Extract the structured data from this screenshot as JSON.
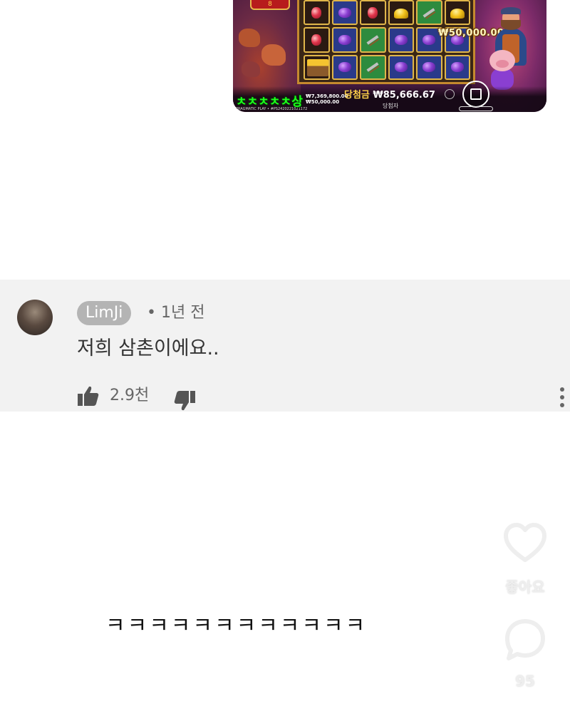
{
  "game": {
    "top_badge": "8",
    "win_amount_center": "₩50,000.00",
    "win_label": "당첨금",
    "win_total": "₩85,666.67",
    "winner_label": "당첨자",
    "balance_line1": "₩7,369,800.00",
    "balance_line2": "₩50,000.00",
    "provider": "PRAGMATIC PLAY • #PS2420221021172",
    "overlay_chars": "ㅊㅊㅊㅊㅊ상"
  },
  "comment": {
    "username": "LimJi",
    "separator": "•",
    "time": "1년 전",
    "text": "저희 삼촌이에요..",
    "like_count": "2.9천"
  },
  "caption": {
    "text": "ㅋㅋㅋㅋㅋㅋㅋㅋㅋㅋㅋㅋ"
  },
  "actions": {
    "like_label": "좋아요",
    "comment_count": "95"
  },
  "colors": {
    "comment_bg": "#f2f2f2",
    "username_pill": "#b4b4b4",
    "overlay_green": "#1eff1e"
  }
}
